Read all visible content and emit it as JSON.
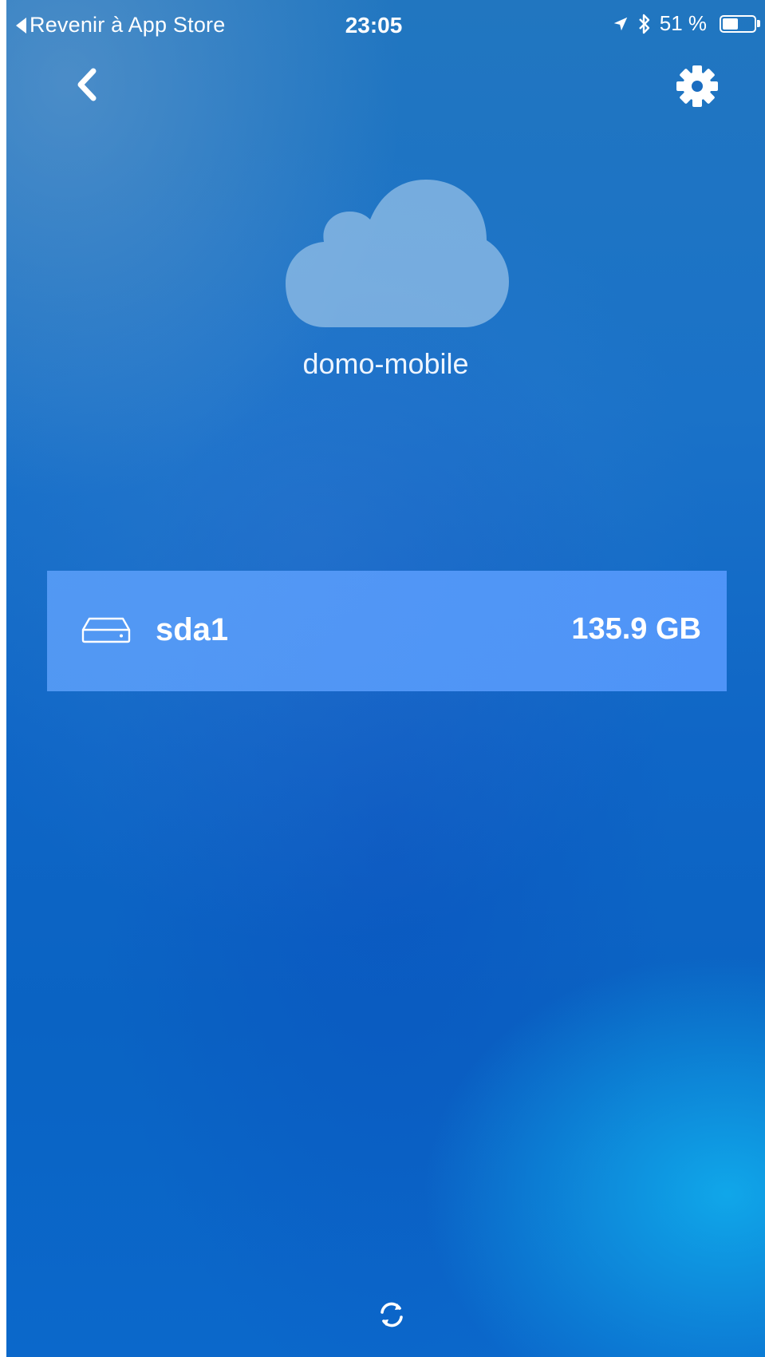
{
  "status_bar": {
    "back_to_app": "Revenir à App Store",
    "time": "23:05",
    "battery_text": "51 %",
    "battery_level_percent": 51,
    "icons": [
      "location-arrow-icon",
      "bluetooth-icon",
      "battery-icon"
    ]
  },
  "nav": {
    "back_icon": "chevron-left-icon",
    "settings_icon": "gear-icon"
  },
  "device": {
    "icon": "cloud-icon",
    "name": "domo-mobile"
  },
  "drives": [
    {
      "icon": "hard-drive-icon",
      "label": "sda1",
      "size": "135.9 GB"
    }
  ],
  "footer": {
    "refresh_icon": "refresh-icon"
  },
  "colors": {
    "background_top": "#2176c0",
    "background_bottom": "#0b68cb",
    "drive_row": "#5498fc",
    "accent_glow": "#10aaeb",
    "text": "#ffffff"
  }
}
